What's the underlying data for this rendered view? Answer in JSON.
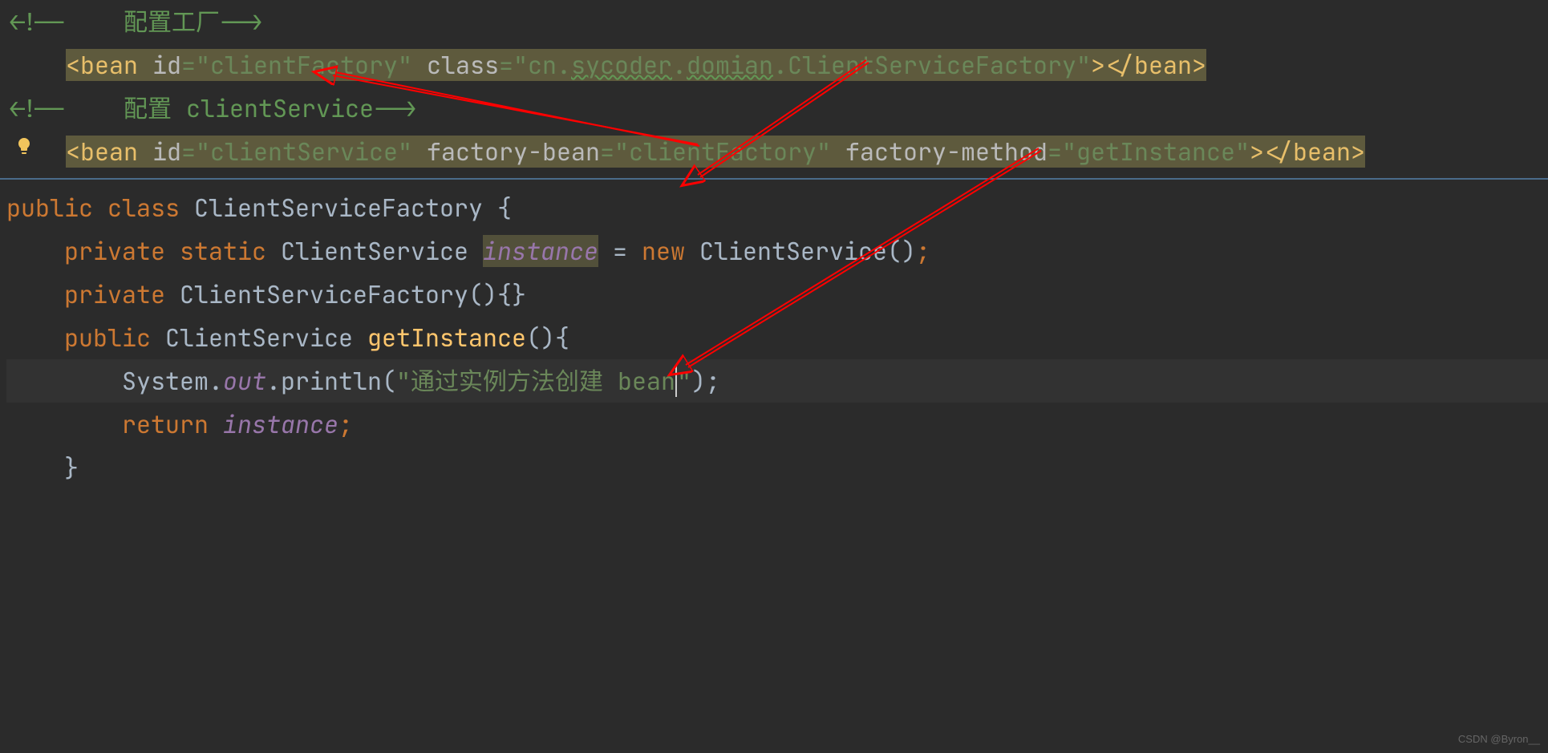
{
  "xml": {
    "comment1_open": "<!--",
    "comment1_text": "    配置工厂",
    "comment1_close": "-->",
    "line1_indent": "    ",
    "bean1_open": "<bean ",
    "bean1_id_attr": "id",
    "bean1_eq": "=",
    "bean1_id_val": "\"clientFactory\"",
    "bean1_class_attr": " class",
    "bean1_class_val": "\"cn.sycoder.domian.ClientServiceFactory\"",
    "bean1_class_val_p1": "\"cn",
    "bean1_class_val_p2": ".",
    "bean1_class_val_p3": "sycoder",
    "bean1_class_val_p4": ".",
    "bean1_class_val_p5": "domian",
    "bean1_class_val_p6": ".",
    "bean1_class_val_p7": "ClientServiceFactory\"",
    "bean1_close": "></bean>",
    "comment2_open": "<!--",
    "comment2_text": "    配置 clientService",
    "comment2_close": "-->",
    "line2_indent": "    ",
    "bean2_open": "<bean ",
    "bean2_id_attr": "id",
    "bean2_id_val": "\"clientService\"",
    "bean2_fb_attr": " factory-bean",
    "bean2_fb_val": "\"clientFactory\"",
    "bean2_fm_attr": " factory-method",
    "bean2_fm_val": "\"getInstance\"",
    "bean2_close": "></bean>"
  },
  "java": {
    "l1_public": "public ",
    "l1_class": "class ",
    "l1_name": "ClientServiceFactory ",
    "l1_brace": "{",
    "l2_indent": "    ",
    "l2_private": "private ",
    "l2_static": "static ",
    "l2_type": "ClientService ",
    "l2_var": "instance",
    "l2_eq": " = ",
    "l2_new": "new ",
    "l2_ctor": "ClientService()",
    "l2_semi": ";",
    "l3_indent": "    ",
    "l3_private": "private ",
    "l3_ctor": "ClientServiceFactory()",
    "l3_braces": "{}",
    "l4_indent": "    ",
    "l4_public": "public ",
    "l4_type": "ClientService ",
    "l4_method": "getInstance",
    "l4_parens": "()",
    "l4_brace": "{",
    "l5_indent": "        ",
    "l5_sys": "System.",
    "l5_out": "out",
    "l5_print": ".println(",
    "l5_str_open": "\"",
    "l5_str_text": "通过实例方法创建 bean",
    "l5_str_close": "\"",
    "l5_end": ");",
    "l6_indent": "        ",
    "l6_return": "return ",
    "l6_var": "instance",
    "l6_semi": ";",
    "l7_indent": "    ",
    "l7_brace": "}"
  },
  "watermark": "CSDN @Byron__"
}
